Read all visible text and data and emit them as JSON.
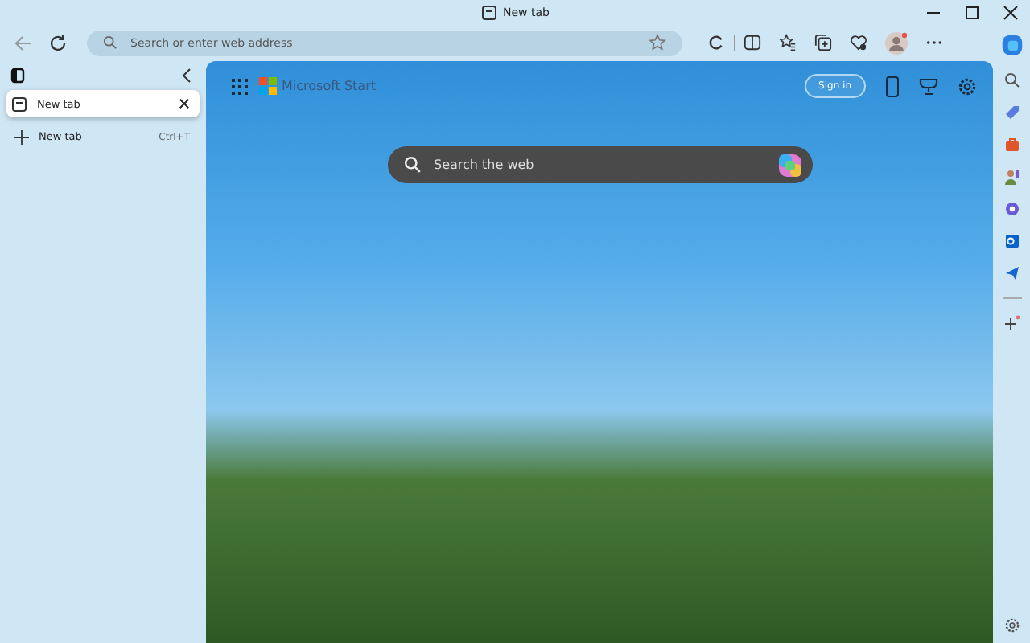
{
  "window": {
    "title": "New tab"
  },
  "address_bar": {
    "placeholder": "Search or enter web address"
  },
  "vertical_tabs": {
    "tabs": [
      {
        "label": "New tab",
        "selected": true
      }
    ],
    "new_tab": {
      "label": "New tab",
      "shortcut": "Ctrl+T"
    }
  },
  "page": {
    "brand": "Microsoft Start",
    "sign_in": "Sign in",
    "search": {
      "placeholder": "Search the web"
    }
  }
}
